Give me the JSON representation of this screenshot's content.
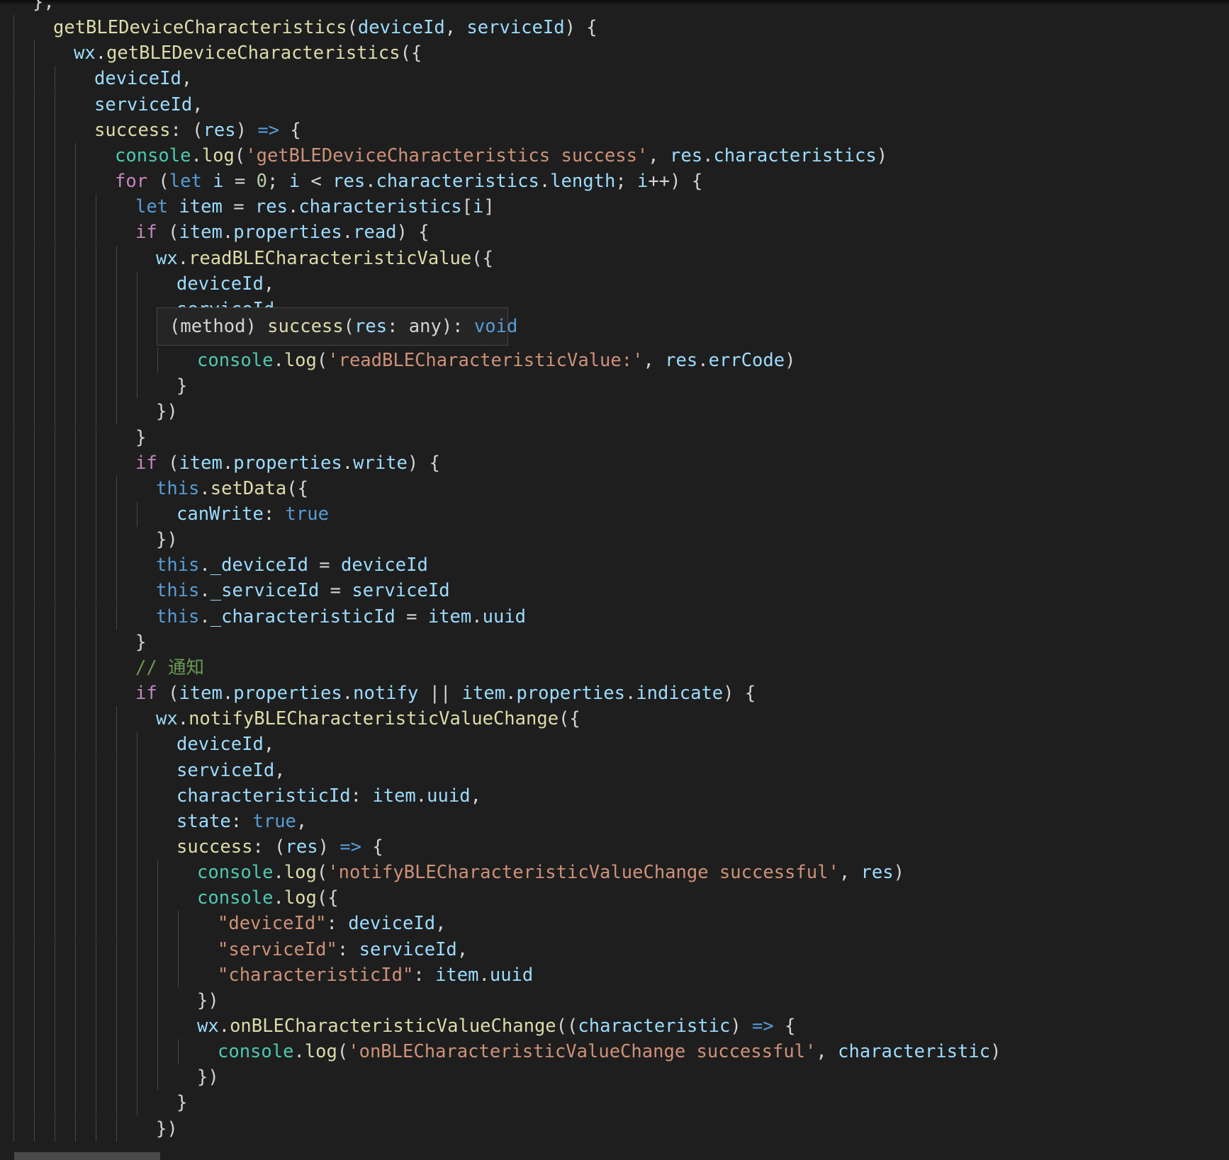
{
  "editor": {
    "language": "javascript",
    "theme_colors": {
      "background": "#1e1e1e",
      "function": "#dcdcaa",
      "variable": "#9cdcfe",
      "keyword": "#569cd6",
      "control": "#c586c0",
      "string": "#ce9178",
      "number": "#b5cea8",
      "class": "#4ec9b0",
      "comment": "#6a9955",
      "punctuation": "#d4d4d4"
    }
  },
  "hover": {
    "tokens": [
      [
        "p",
        "(method) "
      ],
      [
        "fn",
        "success"
      ],
      [
        "p",
        "("
      ],
      [
        "var",
        "res"
      ],
      [
        "p",
        ": any): "
      ],
      [
        "kw",
        "void"
      ]
    ]
  },
  "lines": [
    {
      "indent": 0,
      "tokens": [
        [
          "p",
          "},"
        ]
      ]
    },
    {
      "indent": 1,
      "tokens": [
        [
          "fn",
          "getBLEDeviceCharacteristics"
        ],
        [
          "p",
          "("
        ],
        [
          "var",
          "deviceId"
        ],
        [
          "p",
          ", "
        ],
        [
          "var",
          "serviceId"
        ],
        [
          "p",
          ") {"
        ]
      ]
    },
    {
      "indent": 2,
      "tokens": [
        [
          "var",
          "wx"
        ],
        [
          "p",
          "."
        ],
        [
          "fn",
          "getBLEDeviceCharacteristics"
        ],
        [
          "p",
          "({"
        ]
      ]
    },
    {
      "indent": 3,
      "tokens": [
        [
          "var",
          "deviceId"
        ],
        [
          "p",
          ","
        ]
      ]
    },
    {
      "indent": 3,
      "tokens": [
        [
          "var",
          "serviceId"
        ],
        [
          "p",
          ","
        ]
      ]
    },
    {
      "indent": 3,
      "tokens": [
        [
          "fn",
          "success"
        ],
        [
          "p",
          ": ("
        ],
        [
          "var",
          "res"
        ],
        [
          "p",
          ") "
        ],
        [
          "kw",
          "=>"
        ],
        [
          "p",
          " {"
        ]
      ]
    },
    {
      "indent": 4,
      "tokens": [
        [
          "cls",
          "console"
        ],
        [
          "p",
          "."
        ],
        [
          "fn",
          "log"
        ],
        [
          "p",
          "("
        ],
        [
          "str",
          "'getBLEDeviceCharacteristics success'"
        ],
        [
          "p",
          ", "
        ],
        [
          "var",
          "res"
        ],
        [
          "p",
          "."
        ],
        [
          "var",
          "characteristics"
        ],
        [
          "p",
          ")"
        ]
      ]
    },
    {
      "indent": 4,
      "tokens": [
        [
          "ctrl",
          "for"
        ],
        [
          "p",
          " ("
        ],
        [
          "kw",
          "let"
        ],
        [
          "p",
          " "
        ],
        [
          "var",
          "i"
        ],
        [
          "p",
          " = "
        ],
        [
          "num",
          "0"
        ],
        [
          "p",
          "; "
        ],
        [
          "var",
          "i"
        ],
        [
          "p",
          " < "
        ],
        [
          "var",
          "res"
        ],
        [
          "p",
          "."
        ],
        [
          "var",
          "characteristics"
        ],
        [
          "p",
          "."
        ],
        [
          "var",
          "length"
        ],
        [
          "p",
          "; "
        ],
        [
          "var",
          "i"
        ],
        [
          "p",
          "++) {"
        ]
      ]
    },
    {
      "indent": 5,
      "tokens": [
        [
          "kw",
          "let"
        ],
        [
          "p",
          " "
        ],
        [
          "var",
          "item"
        ],
        [
          "p",
          " = "
        ],
        [
          "var",
          "res"
        ],
        [
          "p",
          "."
        ],
        [
          "var",
          "characteristics"
        ],
        [
          "p",
          "["
        ],
        [
          "var",
          "i"
        ],
        [
          "p",
          "]"
        ]
      ]
    },
    {
      "indent": 5,
      "tokens": [
        [
          "ctrl",
          "if"
        ],
        [
          "p",
          " ("
        ],
        [
          "var",
          "item"
        ],
        [
          "p",
          "."
        ],
        [
          "var",
          "properties"
        ],
        [
          "p",
          "."
        ],
        [
          "var",
          "read"
        ],
        [
          "p",
          ") {"
        ]
      ]
    },
    {
      "indent": 6,
      "tokens": [
        [
          "var",
          "wx"
        ],
        [
          "p",
          "."
        ],
        [
          "fn",
          "readBLECharacteristicValue"
        ],
        [
          "p",
          "({"
        ]
      ]
    },
    {
      "indent": 7,
      "tokens": [
        [
          "var",
          "deviceId"
        ],
        [
          "p",
          ","
        ]
      ]
    },
    {
      "indent": 7,
      "tokens": [
        [
          "var",
          "serviceId"
        ],
        [
          "p",
          ","
        ]
      ]
    },
    {
      "indent": 7,
      "tokens": [
        [
          "fnhl",
          "success"
        ],
        [
          "p",
          " ("
        ],
        [
          "var",
          "res"
        ],
        [
          "p",
          ") {"
        ]
      ]
    },
    {
      "indent": 8,
      "tokens": [
        [
          "cls",
          "console"
        ],
        [
          "p",
          "."
        ],
        [
          "fn",
          "log"
        ],
        [
          "p",
          "("
        ],
        [
          "str",
          "'readBLECharacteristicValue:'"
        ],
        [
          "p",
          ", "
        ],
        [
          "var",
          "res"
        ],
        [
          "p",
          "."
        ],
        [
          "var",
          "errCode"
        ],
        [
          "p",
          ")"
        ]
      ]
    },
    {
      "indent": 7,
      "tokens": [
        [
          "p",
          "}"
        ]
      ]
    },
    {
      "indent": 6,
      "tokens": [
        [
          "p",
          "})"
        ]
      ]
    },
    {
      "indent": 5,
      "tokens": [
        [
          "p",
          "}"
        ]
      ]
    },
    {
      "indent": 5,
      "tokens": [
        [
          "ctrl",
          "if"
        ],
        [
          "p",
          " ("
        ],
        [
          "var",
          "item"
        ],
        [
          "p",
          "."
        ],
        [
          "var",
          "properties"
        ],
        [
          "p",
          "."
        ],
        [
          "var",
          "write"
        ],
        [
          "p",
          ") {"
        ]
      ]
    },
    {
      "indent": 6,
      "tokens": [
        [
          "kw",
          "this"
        ],
        [
          "p",
          "."
        ],
        [
          "fn",
          "setData"
        ],
        [
          "p",
          "({"
        ]
      ]
    },
    {
      "indent": 7,
      "tokens": [
        [
          "var",
          "canWrite"
        ],
        [
          "p",
          ": "
        ],
        [
          "kw",
          "true"
        ]
      ]
    },
    {
      "indent": 6,
      "tokens": [
        [
          "p",
          "})"
        ]
      ]
    },
    {
      "indent": 6,
      "tokens": [
        [
          "kw",
          "this"
        ],
        [
          "p",
          "."
        ],
        [
          "var",
          "_deviceId"
        ],
        [
          "p",
          " = "
        ],
        [
          "var",
          "deviceId"
        ]
      ]
    },
    {
      "indent": 6,
      "tokens": [
        [
          "kw",
          "this"
        ],
        [
          "p",
          "."
        ],
        [
          "var",
          "_serviceId"
        ],
        [
          "p",
          " = "
        ],
        [
          "var",
          "serviceId"
        ]
      ]
    },
    {
      "indent": 6,
      "tokens": [
        [
          "kw",
          "this"
        ],
        [
          "p",
          "."
        ],
        [
          "var",
          "_characteristicId"
        ],
        [
          "p",
          " = "
        ],
        [
          "var",
          "item"
        ],
        [
          "p",
          "."
        ],
        [
          "var",
          "uuid"
        ]
      ]
    },
    {
      "indent": 5,
      "tokens": [
        [
          "p",
          "}"
        ]
      ]
    },
    {
      "indent": 5,
      "tokens": [
        [
          "cmt",
          "// 通知"
        ]
      ]
    },
    {
      "indent": 5,
      "tokens": [
        [
          "ctrl",
          "if"
        ],
        [
          "p",
          " ("
        ],
        [
          "var",
          "item"
        ],
        [
          "p",
          "."
        ],
        [
          "var",
          "properties"
        ],
        [
          "p",
          "."
        ],
        [
          "var",
          "notify"
        ],
        [
          "p",
          " || "
        ],
        [
          "var",
          "item"
        ],
        [
          "p",
          "."
        ],
        [
          "var",
          "properties"
        ],
        [
          "p",
          "."
        ],
        [
          "var",
          "indicate"
        ],
        [
          "p",
          ") {"
        ]
      ]
    },
    {
      "indent": 6,
      "tokens": [
        [
          "var",
          "wx"
        ],
        [
          "p",
          "."
        ],
        [
          "fn",
          "notifyBLECharacteristicValueChange"
        ],
        [
          "p",
          "({"
        ]
      ]
    },
    {
      "indent": 7,
      "tokens": [
        [
          "var",
          "deviceId"
        ],
        [
          "p",
          ","
        ]
      ]
    },
    {
      "indent": 7,
      "tokens": [
        [
          "var",
          "serviceId"
        ],
        [
          "p",
          ","
        ]
      ]
    },
    {
      "indent": 7,
      "tokens": [
        [
          "var",
          "characteristicId"
        ],
        [
          "p",
          ": "
        ],
        [
          "var",
          "item"
        ],
        [
          "p",
          "."
        ],
        [
          "var",
          "uuid"
        ],
        [
          "p",
          ","
        ]
      ]
    },
    {
      "indent": 7,
      "tokens": [
        [
          "var",
          "state"
        ],
        [
          "p",
          ": "
        ],
        [
          "kw",
          "true"
        ],
        [
          "p",
          ","
        ]
      ]
    },
    {
      "indent": 7,
      "tokens": [
        [
          "fn",
          "success"
        ],
        [
          "p",
          ": ("
        ],
        [
          "var",
          "res"
        ],
        [
          "p",
          ") "
        ],
        [
          "kw",
          "=>"
        ],
        [
          "p",
          " {"
        ]
      ]
    },
    {
      "indent": 8,
      "tokens": [
        [
          "cls",
          "console"
        ],
        [
          "p",
          "."
        ],
        [
          "fn",
          "log"
        ],
        [
          "p",
          "("
        ],
        [
          "str",
          "'notifyBLECharacteristicValueChange successful'"
        ],
        [
          "p",
          ", "
        ],
        [
          "var",
          "res"
        ],
        [
          "p",
          ")"
        ]
      ]
    },
    {
      "indent": 8,
      "tokens": [
        [
          "cls",
          "console"
        ],
        [
          "p",
          "."
        ],
        [
          "fn",
          "log"
        ],
        [
          "p",
          "({"
        ]
      ]
    },
    {
      "indent": 9,
      "tokens": [
        [
          "str",
          "\"deviceId\""
        ],
        [
          "p",
          ": "
        ],
        [
          "var",
          "deviceId"
        ],
        [
          "p",
          ","
        ]
      ]
    },
    {
      "indent": 9,
      "tokens": [
        [
          "str",
          "\"serviceId\""
        ],
        [
          "p",
          ": "
        ],
        [
          "var",
          "serviceId"
        ],
        [
          "p",
          ","
        ]
      ]
    },
    {
      "indent": 9,
      "tokens": [
        [
          "str",
          "\"characteristicId\""
        ],
        [
          "p",
          ": "
        ],
        [
          "var",
          "item"
        ],
        [
          "p",
          "."
        ],
        [
          "var",
          "uuid"
        ]
      ]
    },
    {
      "indent": 8,
      "tokens": [
        [
          "p",
          "})"
        ]
      ]
    },
    {
      "indent": 8,
      "tokens": [
        [
          "var",
          "wx"
        ],
        [
          "p",
          "."
        ],
        [
          "fn",
          "onBLECharacteristicValueChange"
        ],
        [
          "p",
          "(("
        ],
        [
          "var",
          "characteristic"
        ],
        [
          "p",
          ") "
        ],
        [
          "kw",
          "=>"
        ],
        [
          "p",
          " {"
        ]
      ]
    },
    {
      "indent": 9,
      "tokens": [
        [
          "cls",
          "console"
        ],
        [
          "p",
          "."
        ],
        [
          "fn",
          "log"
        ],
        [
          "p",
          "("
        ],
        [
          "str",
          "'onBLECharacteristicValueChange successful'"
        ],
        [
          "p",
          ", "
        ],
        [
          "var",
          "characteristic"
        ],
        [
          "p",
          ")"
        ]
      ]
    },
    {
      "indent": 8,
      "tokens": [
        [
          "p",
          "})"
        ]
      ]
    },
    {
      "indent": 7,
      "tokens": [
        [
          "p",
          "}"
        ]
      ]
    },
    {
      "indent": 6,
      "tokens": [
        [
          "p",
          "})"
        ]
      ]
    }
  ]
}
